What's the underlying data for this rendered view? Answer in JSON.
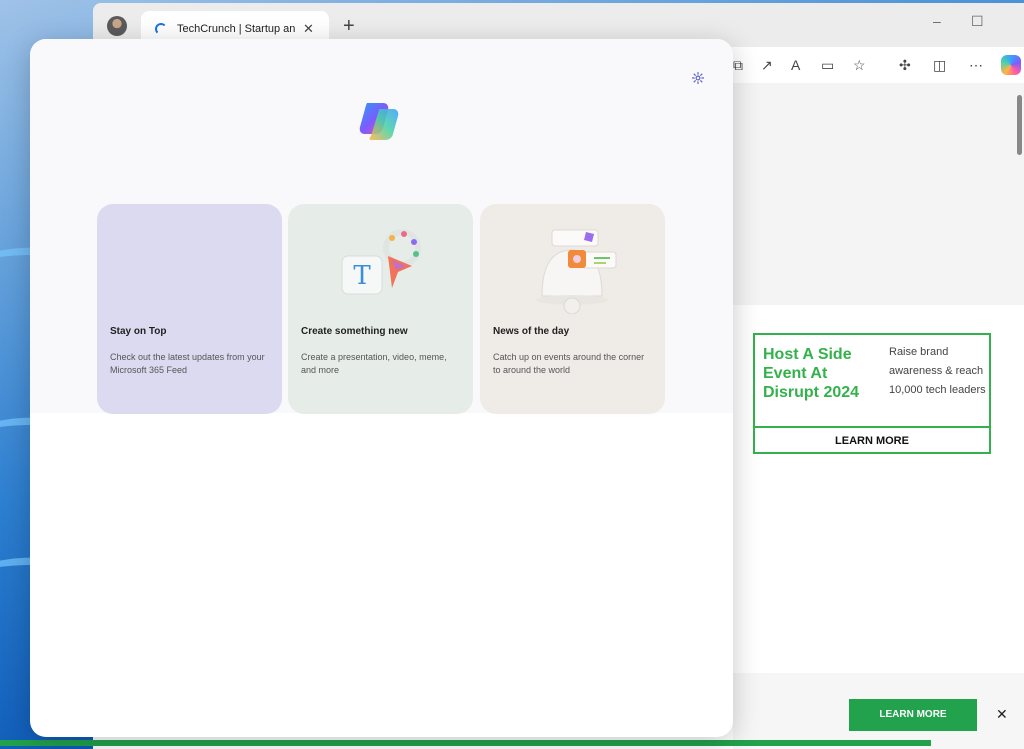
{
  "browser": {
    "tab": {
      "title": "TechCrunch | Startup and Te"
    },
    "new_tab_label": "+",
    "window_controls": {
      "minimize": "–",
      "maximize": "☐",
      "close": "✕"
    }
  },
  "copilot": {
    "cards": [
      {
        "title": "Stay on Top",
        "description": "Check out the latest updates from your Microsoft 365 Feed"
      },
      {
        "title": "Create something new",
        "description": "Create a presentation, video, meme, and more"
      },
      {
        "title": "News of the day",
        "description": "Catch up on events around the corner to around the world"
      }
    ]
  },
  "page": {
    "ad": {
      "headline": "Host A Side Event At Disrupt 2024",
      "copy": "Raise brand awareness & reach 10,000 tech leaders",
      "cta": "LEARN MORE"
    },
    "bottom_banner": {
      "cta": "LEARN MORE",
      "close": "✕"
    }
  },
  "colors": {
    "accent_green": "#33b24b",
    "button_green": "#22a24d"
  },
  "icons": [
    "profile-avatar",
    "loading-spinner-icon",
    "close-icon",
    "plus-icon",
    "minimize-icon",
    "maximize-icon",
    "settings-icon",
    "copilot-logo-icon",
    "extensions-icon",
    "split-screen-icon",
    "more-icon",
    "favorites-icon",
    "read-aloud-icon"
  ]
}
